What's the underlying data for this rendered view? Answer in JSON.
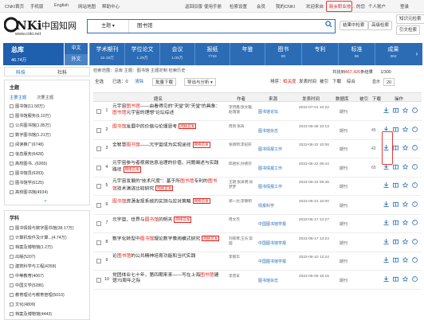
{
  "topbar": {
    "left_links": [
      "CNKI首页",
      "手机版",
      "English",
      "网站地图",
      "帮助中心"
    ],
    "right_links": [
      "返回旧版",
      "使用手册",
      "检索设置",
      "会员",
      "我的CNKI",
      "欢迎来自",
      "新乡职业技...",
      "的您",
      "个人账户",
      "登录"
    ]
  },
  "header": {
    "logo_main": "CNKi中国知网",
    "logo_url": "www.cnki.net",
    "search_field": "主题",
    "search_value": "图书馆",
    "btn_in_results": "结果中检索",
    "btn_advanced": "高级检索",
    "btn_knowledge": "知识元检索",
    "btn_citation": "引文检索"
  },
  "nav": {
    "total_label": "总库",
    "total_count": "46.74万",
    "lang_cn": "中文",
    "lang_foreign": "外文",
    "categories": [
      {
        "name": "学术期刊",
        "count": "22.18万"
      },
      {
        "name": "学位论文",
        "count": "1.29万"
      },
      {
        "name": "会议",
        "count": "1.06万"
      },
      {
        "name": "报纸",
        "count": "7744"
      },
      {
        "name": "年鉴",
        "count": ""
      },
      {
        "name": "图书",
        "count": "80"
      },
      {
        "name": "专利",
        "count": ""
      },
      {
        "name": "标准",
        "count": "86"
      },
      {
        "name": "成果",
        "count": "362"
      }
    ],
    "more_arrow": "›"
  },
  "left": {
    "tab_discipline": "科技",
    "tab_social": "社科",
    "topic_title": "主题",
    "topic_sub_main": "主要主题",
    "topic_sub_second": "次要主题",
    "topics": [
      "图书馆(11.58万)",
      "图书馆服务(6.10万)",
      "公共图书馆(1.85万)",
      "数字图书馆(1.21万)",
      "阅读推广(6748)",
      "信息服务(6428)",
      "高校图书...(6365)",
      "图书馆员(6283)",
      "图书馆学(6125)",
      "高校图书馆(4934)"
    ],
    "more_arrow": "⌄",
    "subject_title": "学科",
    "subjects": [
      "图书情报与数字图书馆(38.17万)",
      "计算机软件及计算...(4.74万)",
      "档案及博物馆(1.2万)",
      "出版(5207)",
      "建筑科学与工程(4358)",
      "中等教育(4067)",
      "中国文学(5286)",
      "教育理论与教育管理(5010)",
      "文化(4809)",
      "档案及博物馆(4443)"
    ]
  },
  "main": {
    "crumb": "检索范围：总库  主题：图书馆  主题定制  检索历史",
    "select_all": "全选",
    "cleared": "已选：0",
    "clear": "清除",
    "batch_download": "批量下载",
    "export": "导出与分析 ▾",
    "sort_label": "排序：",
    "sort_options": [
      "相关度",
      "发表时间",
      "被引",
      "下载",
      "综合"
    ],
    "result_count_label": "共找到",
    "result_count": "467,426",
    "result_count_suffix": "条结果",
    "page": "1/300",
    "page_size_label": "显示",
    "page_size": "20",
    "columns": [
      "题名",
      "作者",
      "来源",
      "发表时间",
      "数据库",
      "被引",
      "下载",
      "操作"
    ],
    "rows": [
      {
        "num": "1",
        "pre": "元宇宙",
        "hl": "图书馆",
        "post": "——由看得见的“天堂”到“天堂”的具象：",
        "hl2": "图书馆",
        "post2": "元宇宙的理想”论坛综述",
        "net": "",
        "author": "李玥鑫;张文雅;赵瑞瑞",
        "source": "图书馆论坛",
        "date": "2022-07-01 10:22",
        "db": "期刊",
        "cite": "",
        "dl": "",
        "net_flag": false
      },
      {
        "num": "2",
        "pre": "",
        "hl": "图书馆",
        "post": "发展中的价值与伦理思考",
        "hl2": "",
        "post2": "",
        "net": "网络首发",
        "author": "周贺;张寿",
        "source": "图书馆杂志",
        "date": "2022-06-28 10:13",
        "db": "期刊",
        "cite": "",
        "dl": "45",
        "net_flag": true
      },
      {
        "num": "3",
        "pre": "全智慧",
        "hl": "图书馆",
        "post": "——元宇宙成为实现途径",
        "hl2": "",
        "post2": "",
        "net": "网络首发",
        "author": "张晓明;李纪轩",
        "source": "图书情报工作",
        "date": "2022-06-22 10:06",
        "db": "期刊",
        "cite": "",
        "dl": "42",
        "net_flag": true
      },
      {
        "num": "4",
        "pre": "元宇宙参与者视频信息治理的价值、问题阐述与实践路径",
        "hl": "",
        "post": "",
        "hl2": "",
        "post2": "",
        "net": "网络首发",
        "author": "邱君杉;孙德芬",
        "source": "图书情报工作",
        "date": "2022-06-22 09:44",
        "db": "期刊",
        "cite": "",
        "dl": "65",
        "net_flag": true
      },
      {
        "num": "5",
        "pre": "元宇宙发展的“技术尺度”：基于所",
        "hl": "图书馆",
        "post": "专利的",
        "hl2": "图书馆",
        "post2": "技术演进比较研究",
        "net": "网络首发",
        "author": "王艳;张采明;徐梦梦",
        "source": "图书情报工作",
        "date": "2022-06-22 09:46",
        "db": "期刊",
        "cite": "",
        "dl": "",
        "net_flag": true
      },
      {
        "num": "6",
        "pre": "",
        "hl": "图书馆",
        "post": "资源发现系统的实测与应对策略",
        "hl2": "",
        "post2": "",
        "net": "网络首发",
        "author": "郑一达;李锦明",
        "source": "情报科学",
        "date": "2022-06-21 10:00",
        "db": "期刊",
        "cite": "",
        "dl": "",
        "net_flag": true
      },
      {
        "num": "7",
        "pre": "元宇宙、世界与",
        "hl": "图书馆",
        "post": "的明天",
        "hl2": "",
        "post2": "",
        "net": "网络首发",
        "author": "周文杰",
        "source": "中国图书馆学报",
        "date": "2022-06-17 13:27",
        "db": "期刊",
        "cite": "",
        "dl": "",
        "net_flag": true
      },
      {
        "num": "8",
        "pre": "数字化转型中",
        "hl": "图书馆",
        "post": "理论数字像阅模式研究",
        "hl2": "",
        "post2": "",
        "net": "网络首发",
        "author": "刘筱寒;王乐;常国",
        "source": "中国图书馆学报",
        "date": "2022-06-17 13:24",
        "db": "期刊",
        "cite": "",
        "dl": "",
        "net_flag": true
      },
      {
        "num": "9",
        "pre": "论",
        "hl": "图书馆",
        "post": "的公共精神培育功能和当代实践",
        "hl2": "",
        "post2": "",
        "net": "",
        "author": "李锁华",
        "source": "中国图书馆学报",
        "date": "2022-06-10 13:24",
        "db": "期刊",
        "cite": "",
        "dl": "",
        "net_flag": false
      },
      {
        "num": "10",
        "pre": "党团体业七十年，第四期来来——写在上海",
        "hl": "图书馆",
        "post": "建馆70周年之际",
        "hl2": "",
        "post2": "",
        "net": "",
        "author": "李曾军",
        "source": "图书馆杂志",
        "date": "2022-06-09 15:15",
        "db": "期刊",
        "cite": "",
        "dl": "",
        "net_flag": false
      }
    ]
  },
  "icons": {
    "download": "download-icon",
    "read": "read-icon",
    "favorite": "favorite-icon",
    "cite": "cite-icon"
  },
  "colors": {
    "brand_blue": "#2b6cb5",
    "highlight_red": "#e0241c",
    "annotation_red": "#e53935"
  }
}
